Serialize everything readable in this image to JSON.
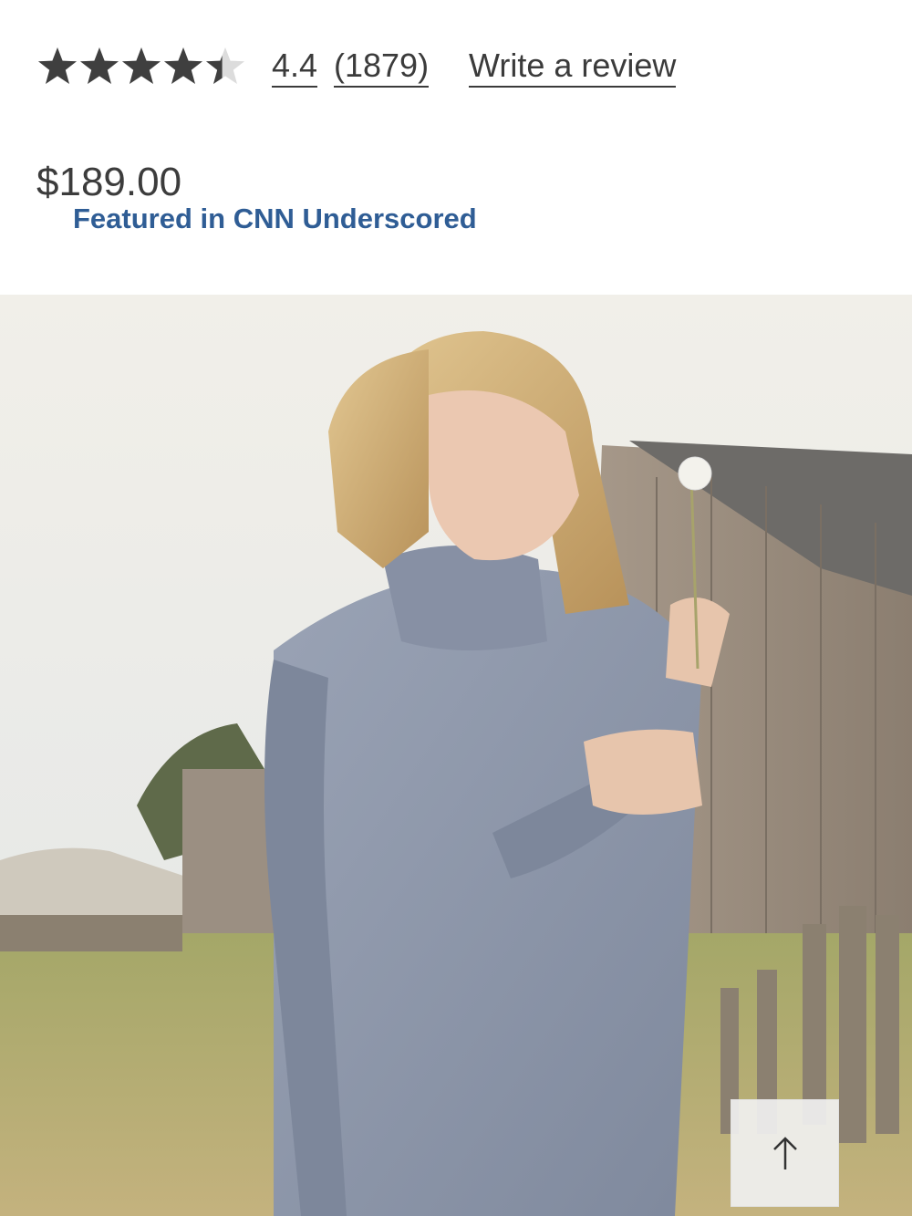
{
  "rating": {
    "value_text": "4.4",
    "count_text": "(1879)",
    "stars_value": 4.4,
    "stars_max": 5,
    "write_review_label": "Write a review"
  },
  "price": {
    "amount": "$189.00",
    "badge": "Featured in CNN Underscored"
  },
  "hero": {
    "icon": "product-photo"
  },
  "back_to_top": {
    "icon": "arrow-up-icon"
  },
  "colors": {
    "text": "#3b3b3b",
    "star": "#3f3f3f",
    "star_empty": "#dcdcdc",
    "link_blue": "#2f5d95",
    "sweater": "#8d97aa"
  }
}
